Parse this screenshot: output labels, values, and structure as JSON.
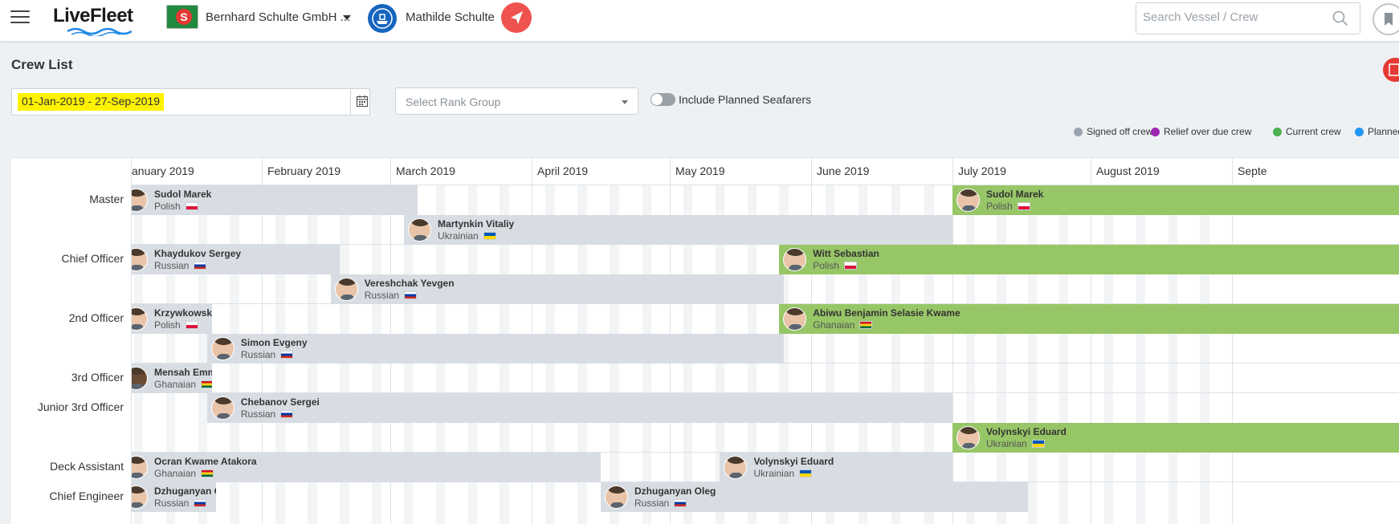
{
  "header": {
    "app_name": "LiveFleet",
    "company": "Bernhard Schulte GmbH ...",
    "company_badge": "S",
    "vessel": "Mathilde Schulte",
    "search_placeholder": "Search Vessel / Crew"
  },
  "page": {
    "title": "Crew List",
    "date_range": "01-Jan-2019 - 27-Sep-2019",
    "rank_group_placeholder": "Select Rank Group",
    "include_planned_label": "Include Planned Seafarers",
    "include_planned_on": false
  },
  "legend": [
    {
      "label": "Signed off crew",
      "color": "#9aa3ad"
    },
    {
      "label": "Relief over due crew",
      "color": "#9c27b0"
    },
    {
      "label": "Current crew",
      "color": "#4caf50"
    },
    {
      "label": "Planned c",
      "color": "#2196f3"
    }
  ],
  "months": [
    "January 2019",
    "February 2019",
    "March 2019",
    "April 2019",
    "May 2019",
    "June 2019",
    "July 2019",
    "August 2019",
    "Septe"
  ],
  "ranks": [
    {
      "label": "Master",
      "lanes": 2
    },
    {
      "label": "Chief Officer",
      "lanes": 2
    },
    {
      "label": "2nd Officer",
      "lanes": 2
    },
    {
      "label": "3rd Officer",
      "lanes": 1
    },
    {
      "label": "Junior 3rd Officer",
      "lanes": 2
    },
    {
      "label": "Deck Assistant",
      "lanes": 1
    },
    {
      "label": "Chief Engineer",
      "lanes": 2
    }
  ],
  "flags": {
    "Polish": [
      "#ffffff",
      "#dc143c"
    ],
    "Ukrainian": [
      "#0057b7",
      "#ffd700"
    ],
    "Russian": [
      "#ffffff",
      "#0039a6",
      "#d52b1e"
    ],
    "Ghanaian": [
      "#ce1126",
      "#fcd116",
      "#006b3f"
    ]
  },
  "colors": {
    "signed_off_bar": "#d8dde3",
    "current_bar": "#97c667"
  },
  "assignments": [
    {
      "rank": 0,
      "lane": 0,
      "name": "Sudol Marek",
      "nationality": "Polish",
      "status": "off",
      "start": "2019-01-01",
      "end": "2019-03-07"
    },
    {
      "rank": 0,
      "lane": 1,
      "name": "Martynkin Vitaliy",
      "nationality": "Ukrainian",
      "status": "off",
      "start": "2019-03-04",
      "end": "2019-07-01"
    },
    {
      "rank": 0,
      "lane": 0,
      "name": "Sudol Marek",
      "nationality": "Polish",
      "status": "cur",
      "start": "2019-07-01",
      "end": "2019-09-27"
    },
    {
      "rank": 1,
      "lane": 0,
      "name": "Khaydukov Sergey",
      "nationality": "Russian",
      "status": "off",
      "start": "2019-01-01",
      "end": "2019-02-18"
    },
    {
      "rank": 1,
      "lane": 1,
      "name": "Vereshchak Yevgen",
      "nationality": "Russian",
      "status": "off",
      "start": "2019-02-16",
      "end": "2019-05-26"
    },
    {
      "rank": 1,
      "lane": 0,
      "name": "Witt Sebastian",
      "nationality": "Polish",
      "status": "cur",
      "start": "2019-05-25",
      "end": "2019-09-27"
    },
    {
      "rank": 2,
      "lane": 0,
      "name": "Krzywkowski Ł",
      "nationality": "Polish",
      "status": "off",
      "start": "2019-01-01",
      "end": "2019-01-21"
    },
    {
      "rank": 2,
      "lane": 1,
      "name": "Simon Evgeny",
      "nationality": "Russian",
      "status": "off",
      "start": "2019-01-20",
      "end": "2019-05-26"
    },
    {
      "rank": 2,
      "lane": 0,
      "name": "Abiwu Benjamin Selasie Kwame",
      "nationality": "Ghanaian",
      "status": "cur",
      "start": "2019-05-25",
      "end": "2019-09-27"
    },
    {
      "rank": 3,
      "lane": 0,
      "name": "Mensah Emma",
      "nationality": "Ghanaian",
      "status": "off",
      "start": "2019-01-01",
      "end": "2019-01-21"
    },
    {
      "rank": 4,
      "lane": 0,
      "name": "Chebanov Sergei",
      "nationality": "Russian",
      "status": "off",
      "start": "2019-01-20",
      "end": "2019-07-01"
    },
    {
      "rank": 4,
      "lane": 1,
      "name": "Volynskyi Eduard",
      "nationality": "Ukrainian",
      "status": "cur",
      "start": "2019-07-01",
      "end": "2019-09-27"
    },
    {
      "rank": 5,
      "lane": 0,
      "name": "Ocran Kwame Atakora",
      "nationality": "Ghanaian",
      "status": "off",
      "start": "2019-01-01",
      "end": "2019-04-16"
    },
    {
      "rank": 5,
      "lane": 0,
      "name": "Volynskyi Eduard",
      "nationality": "Ukrainian",
      "status": "off",
      "start": "2019-05-12",
      "end": "2019-07-01"
    },
    {
      "rank": 6,
      "lane": 0,
      "name": "Dzhuganyan Ole",
      "nationality": "Russian",
      "status": "off",
      "start": "2019-01-01",
      "end": "2019-01-22"
    },
    {
      "rank": 6,
      "lane": 0,
      "name": "Dzhuganyan Oleg",
      "nationality": "Russian",
      "status": "off",
      "start": "2019-04-16",
      "end": "2019-07-18"
    }
  ]
}
